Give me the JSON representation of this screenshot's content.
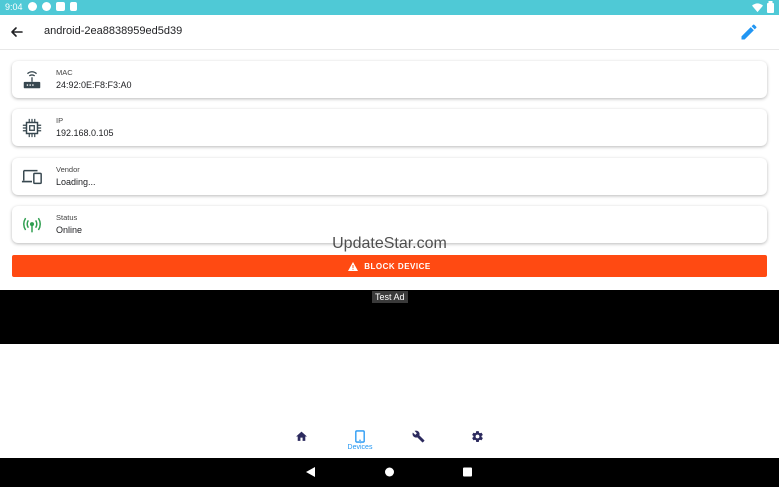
{
  "status_bar": {
    "time": "9:04"
  },
  "app_bar": {
    "title": "android-2ea8838959ed5d39"
  },
  "cards": [
    {
      "label": "MAC",
      "value": "24:92:0E:F8:F3:A0",
      "icon": "router-icon"
    },
    {
      "label": "IP",
      "value": "192.168.0.105",
      "icon": "chip-icon"
    },
    {
      "label": "Vendor",
      "value": "Loading...",
      "icon": "devices-icon"
    },
    {
      "label": "Status",
      "value": "Online",
      "icon": "signal-icon"
    }
  ],
  "block_button": {
    "label": "BLOCK DEVICE"
  },
  "watermark": "UpdateStar.com",
  "ad": {
    "label": "Test Ad"
  },
  "bottom_nav": {
    "active_label": "Devices",
    "items": [
      "home-icon",
      "tablet-icon",
      "wrench-icon",
      "settings-icon"
    ]
  },
  "colors": {
    "status_bar": "#4fc9d6",
    "accent": "#2196f3",
    "danger": "#ff4a12",
    "online": "#2e9e4f",
    "nav_icon": "#2c2a5e"
  }
}
